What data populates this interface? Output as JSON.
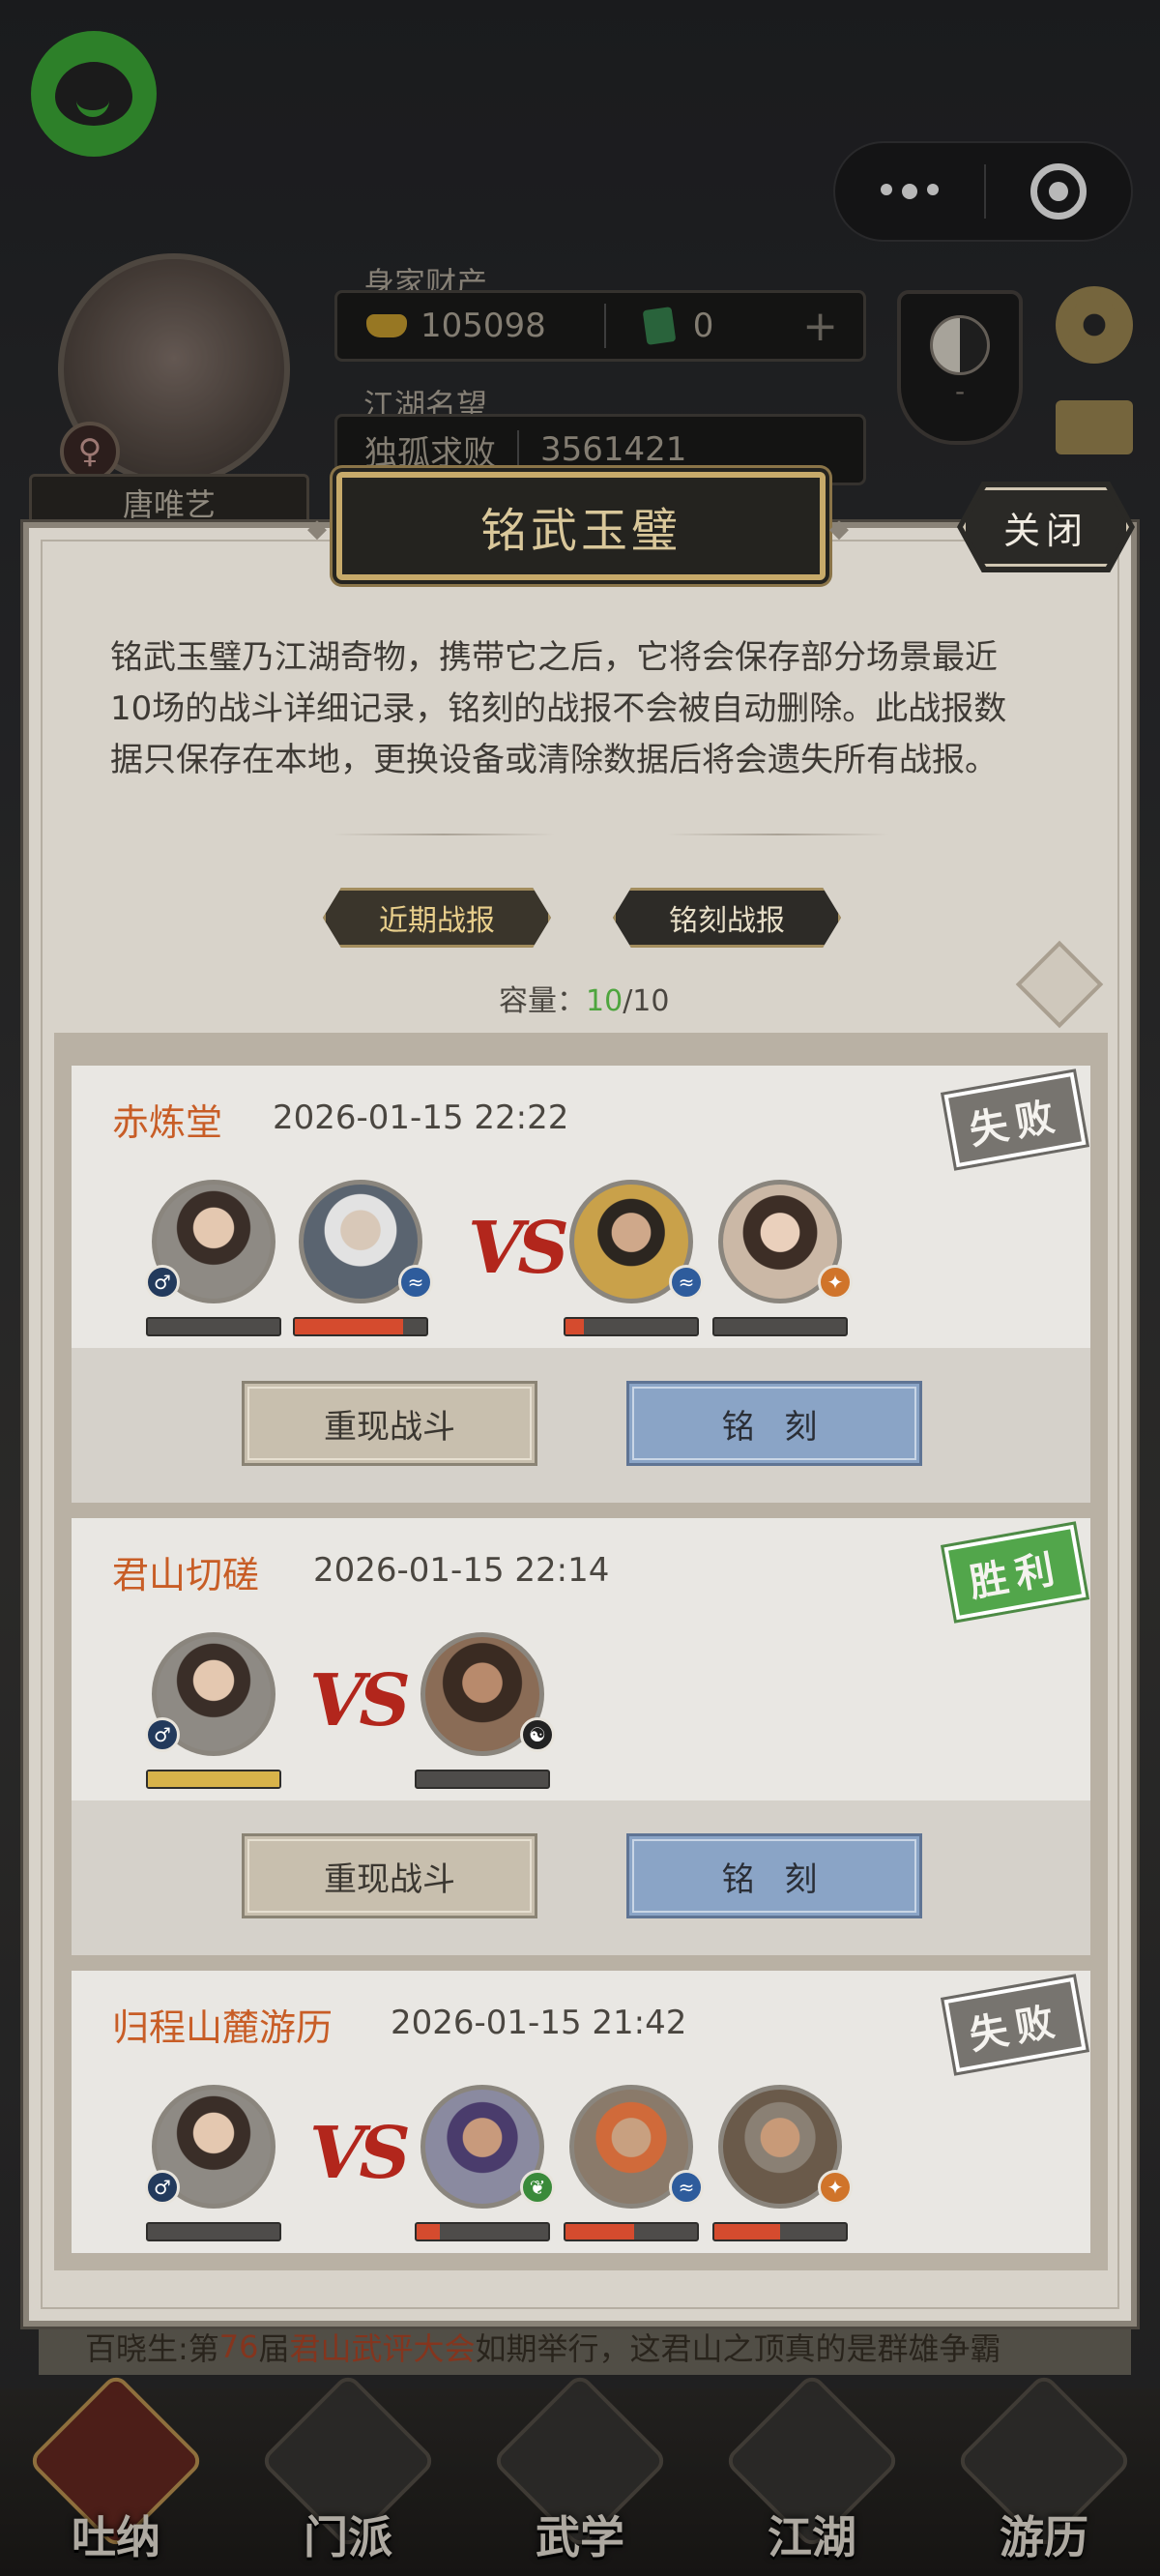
{
  "hud": {
    "player_name": "唐唯艺",
    "wealth_label": "身家财产",
    "gold": "105098",
    "gems": "0",
    "plus": "+",
    "fame_label": "江湖名望",
    "fame_title": "独孤求败",
    "fame_value": "3561421",
    "taiji_dash": "-"
  },
  "ticker": {
    "prefix": "百晓生:第",
    "number": "76",
    "middle": "届",
    "event": "君山武评大会",
    "suffix": "如期举行，这君山之顶真的是群雄争霸"
  },
  "nav": {
    "items": [
      {
        "label": "吐纳"
      },
      {
        "label": "门派"
      },
      {
        "label": "武学"
      },
      {
        "label": "江湖"
      },
      {
        "label": "游历"
      }
    ]
  },
  "modal": {
    "title": "铭武玉璧",
    "close_label": "关闭",
    "description": "铭武玉璧乃江湖奇物，携带它之后，它将会保存部分场景最近10场的战斗详细记录，铭刻的战报不会被自动删除。此战报数据只保存在本地，更换设备或清除数据后将会遗失所有战报。",
    "tabs": [
      {
        "label": "近期战报"
      },
      {
        "label": "铭刻战报"
      }
    ],
    "capacity_label": "容量：",
    "capacity_current": "10",
    "capacity_max": "/10",
    "replay_label": "重现战斗",
    "engrave_label": "铭 刻",
    "vs_label": "VS"
  },
  "battles": [
    {
      "location": "赤炼堂",
      "time": "2026-01-15 22:22",
      "result": "失败",
      "allies_hp": [
        0,
        0.82
      ],
      "enemies_hp": [
        0.14,
        0
      ]
    },
    {
      "location": "君山切磋",
      "time": "2026-01-15 22:14",
      "result": "胜利",
      "allies_hp": [
        1.0
      ],
      "enemies_hp": [
        0
      ]
    },
    {
      "location": "归程山麓游历",
      "time": "2026-01-15 21:42",
      "result": "失败",
      "allies_hp": [
        0
      ],
      "enemies_hp": [
        0.18,
        0.52,
        0.5
      ]
    }
  ],
  "colors": {
    "accent_gold": "#c7aa6a",
    "location_orange": "#c85d26",
    "win_green": "#52a64b",
    "lose_gray": "#77746f",
    "hp_red": "#d54b2e",
    "engrave_blue": "#8aa4c6"
  }
}
